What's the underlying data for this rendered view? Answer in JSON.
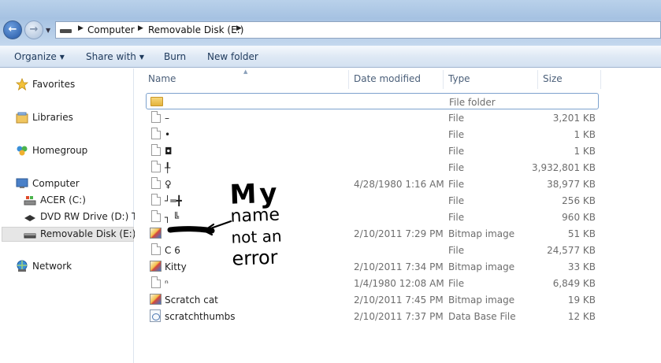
{
  "address": {
    "segments": [
      "Computer",
      "Removable Disk (E:)"
    ]
  },
  "toolbar": {
    "organize": "Organize",
    "share_with": "Share with",
    "burn": "Burn",
    "new_folder": "New folder"
  },
  "nav": {
    "favorites": "Favorites",
    "libraries": "Libraries",
    "homegroup": "Homegroup",
    "computer": "Computer",
    "acer": "ACER (C:)",
    "dvd": "DVD RW Drive (D:) Tab",
    "removable": "Removable Disk (E:)",
    "network": "Network"
  },
  "columns": {
    "name": "Name",
    "date": "Date modified",
    "type": "Type",
    "size": "Size"
  },
  "files": [
    {
      "name": "",
      "date": "",
      "type": "File folder",
      "size": "",
      "icon": "folder-icon"
    },
    {
      "name": "–",
      "date": "",
      "type": "File",
      "size": "3,201 KB",
      "icon": "file-icon"
    },
    {
      "name": "•",
      "date": "",
      "type": "File",
      "size": "1 KB",
      "icon": "file-icon"
    },
    {
      "name": "◘",
      "date": "",
      "type": "File",
      "size": "1 KB",
      "icon": "file-icon"
    },
    {
      "name": "╀",
      "date": "",
      "type": "File",
      "size": "3,932,801 KB",
      "icon": "file-icon"
    },
    {
      "name": "♀",
      "date": "4/28/1980 1:16 AM",
      "type": "File",
      "size": "38,977 KB",
      "icon": "file-icon"
    },
    {
      "name": "┘═╋",
      "date": "",
      "type": "File",
      "size": "256 KB",
      "icon": "file-icon"
    },
    {
      "name": "┐ ╚",
      "date": "",
      "type": "File",
      "size": "960 KB",
      "icon": "file-icon"
    },
    {
      "name": "",
      "date": "2/10/2011 7:29 PM",
      "type": "Bitmap image",
      "size": "51 KB",
      "icon": "bitmap-icon"
    },
    {
      "name": "C    6",
      "date": "",
      "type": "File",
      "size": "24,577 KB",
      "icon": "file-icon"
    },
    {
      "name": "Kitty",
      "date": "2/10/2011 7:34 PM",
      "type": "Bitmap image",
      "size": "33 KB",
      "icon": "bitmap-icon"
    },
    {
      "name": "ⁿ",
      "date": "1/4/1980 12:08 AM",
      "type": "File",
      "size": "6,849 KB",
      "icon": "file-icon"
    },
    {
      "name": "Scratch cat",
      "date": "2/10/2011 7:45 PM",
      "type": "Bitmap image",
      "size": "19 KB",
      "icon": "bitmap-icon"
    },
    {
      "name": "scratchthumbs",
      "date": "2/10/2011 7:37 PM",
      "type": "Data Base File",
      "size": "12 KB",
      "icon": "database-icon"
    }
  ],
  "annotation": {
    "text": [
      "My",
      "name",
      "not an",
      "error"
    ]
  }
}
